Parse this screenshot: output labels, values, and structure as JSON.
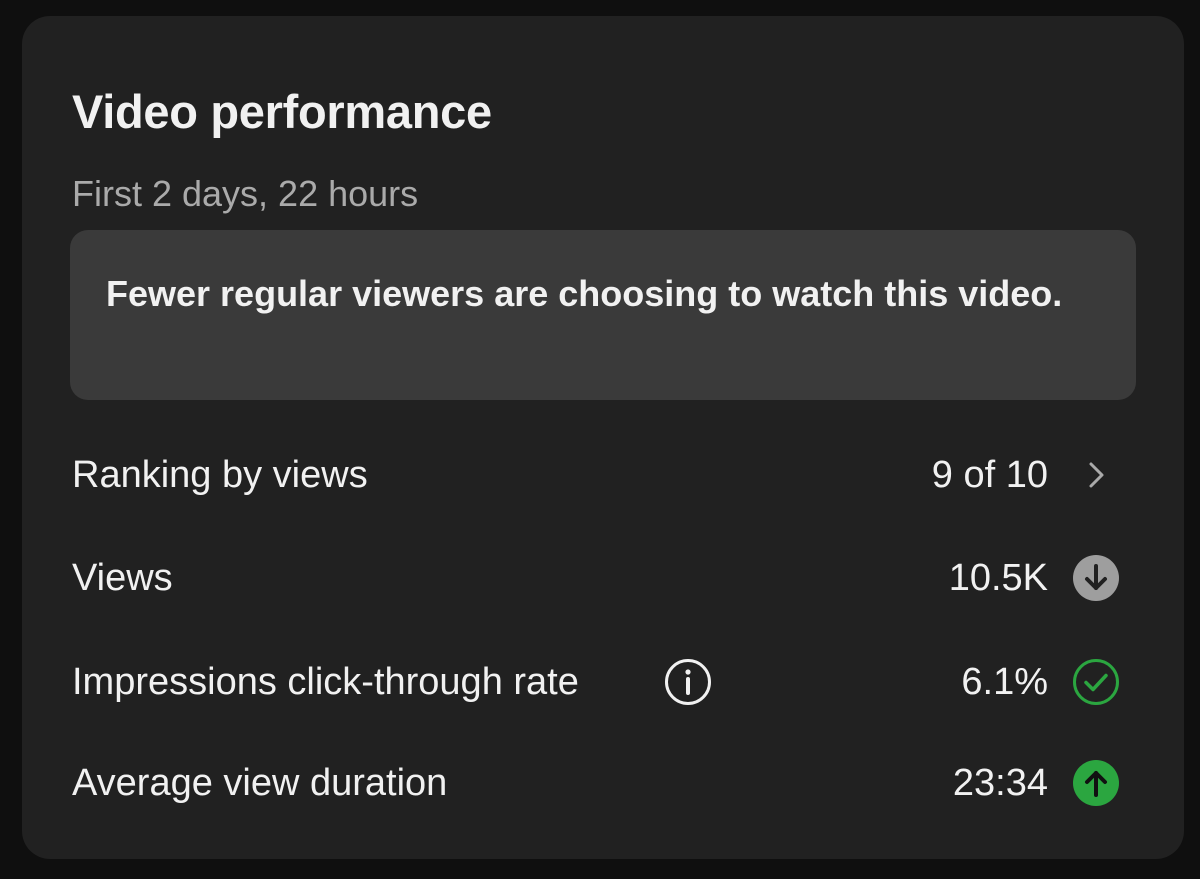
{
  "card": {
    "title": "Video performance",
    "subtitle": "First 2 days, 22 hours",
    "insight": "Fewer regular viewers are choosing to watch this video."
  },
  "rows": [
    {
      "label": "Ranking by views",
      "value": "9 of 10",
      "icon": "chevron-right-icon"
    },
    {
      "label": "Views",
      "value": "10.5K",
      "icon": "arrow-down-circle-icon"
    },
    {
      "label": "Impressions click-through rate",
      "value": "6.1%",
      "icon": "check-circle-icon",
      "info_icon": "info-icon"
    },
    {
      "label": "Average view duration",
      "value": "23:34",
      "icon": "arrow-up-circle-icon"
    }
  ],
  "colors": {
    "background": "#0f0f0f",
    "card": "#212121",
    "insight_box": "#3a3a3a",
    "text_primary": "#f1f1f1",
    "text_secondary": "#aaaaaa",
    "status_down": "#9e9e9e",
    "status_good": "#2ba640",
    "status_up": "#2ba640"
  }
}
